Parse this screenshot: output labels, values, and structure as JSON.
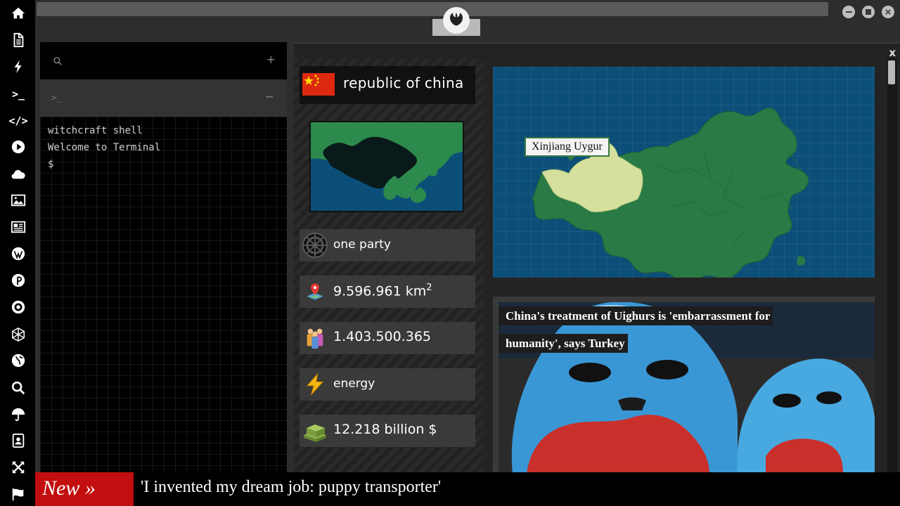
{
  "rail": {
    "items": [
      {
        "name": "home-icon"
      },
      {
        "name": "document-icon"
      },
      {
        "name": "bolt-icon"
      },
      {
        "name": "terminal-icon",
        "text": ">_"
      },
      {
        "name": "code-icon",
        "text": "</>"
      },
      {
        "name": "play-icon"
      },
      {
        "name": "cloud-icon"
      },
      {
        "name": "image-icon"
      },
      {
        "name": "newspaper-icon"
      },
      {
        "name": "wordpress-icon"
      },
      {
        "name": "pinterest-icon"
      },
      {
        "name": "empire-icon"
      },
      {
        "name": "globe-mesh-icon"
      },
      {
        "name": "globe-icon"
      },
      {
        "name": "search-icon"
      },
      {
        "name": "umbrella-icon"
      },
      {
        "name": "contact-card-icon"
      },
      {
        "name": "expand-icon"
      },
      {
        "name": "flag-icon"
      }
    ]
  },
  "terminal": {
    "add_label": "+",
    "tab_prompt": ">_",
    "collapse_label": "−",
    "lines": [
      "witchcraft shell",
      "Welcome to Terminal",
      "$"
    ]
  },
  "country": {
    "name": "republic of china",
    "government": "one party",
    "area": "9.596.961 km",
    "area_unit_sup": "2",
    "population": "1.403.500.365",
    "resource": "energy",
    "gdp": "12.218 billion $"
  },
  "map": {
    "tooltip": "Xinjiang Uygur"
  },
  "news": {
    "title": "China's treatment of Uighurs is 'embarrassment for humanity', says Turkey"
  },
  "ticker": {
    "badge": "New »",
    "headline": "'I invented my dream job: puppy transporter'"
  },
  "close_label": "x",
  "colors": {
    "land": "#2a7a45",
    "highlight": "#d4e09b",
    "ocean": "#0b4f78",
    "ticker_red": "#c20e0e",
    "flag_red": "#de2910"
  }
}
